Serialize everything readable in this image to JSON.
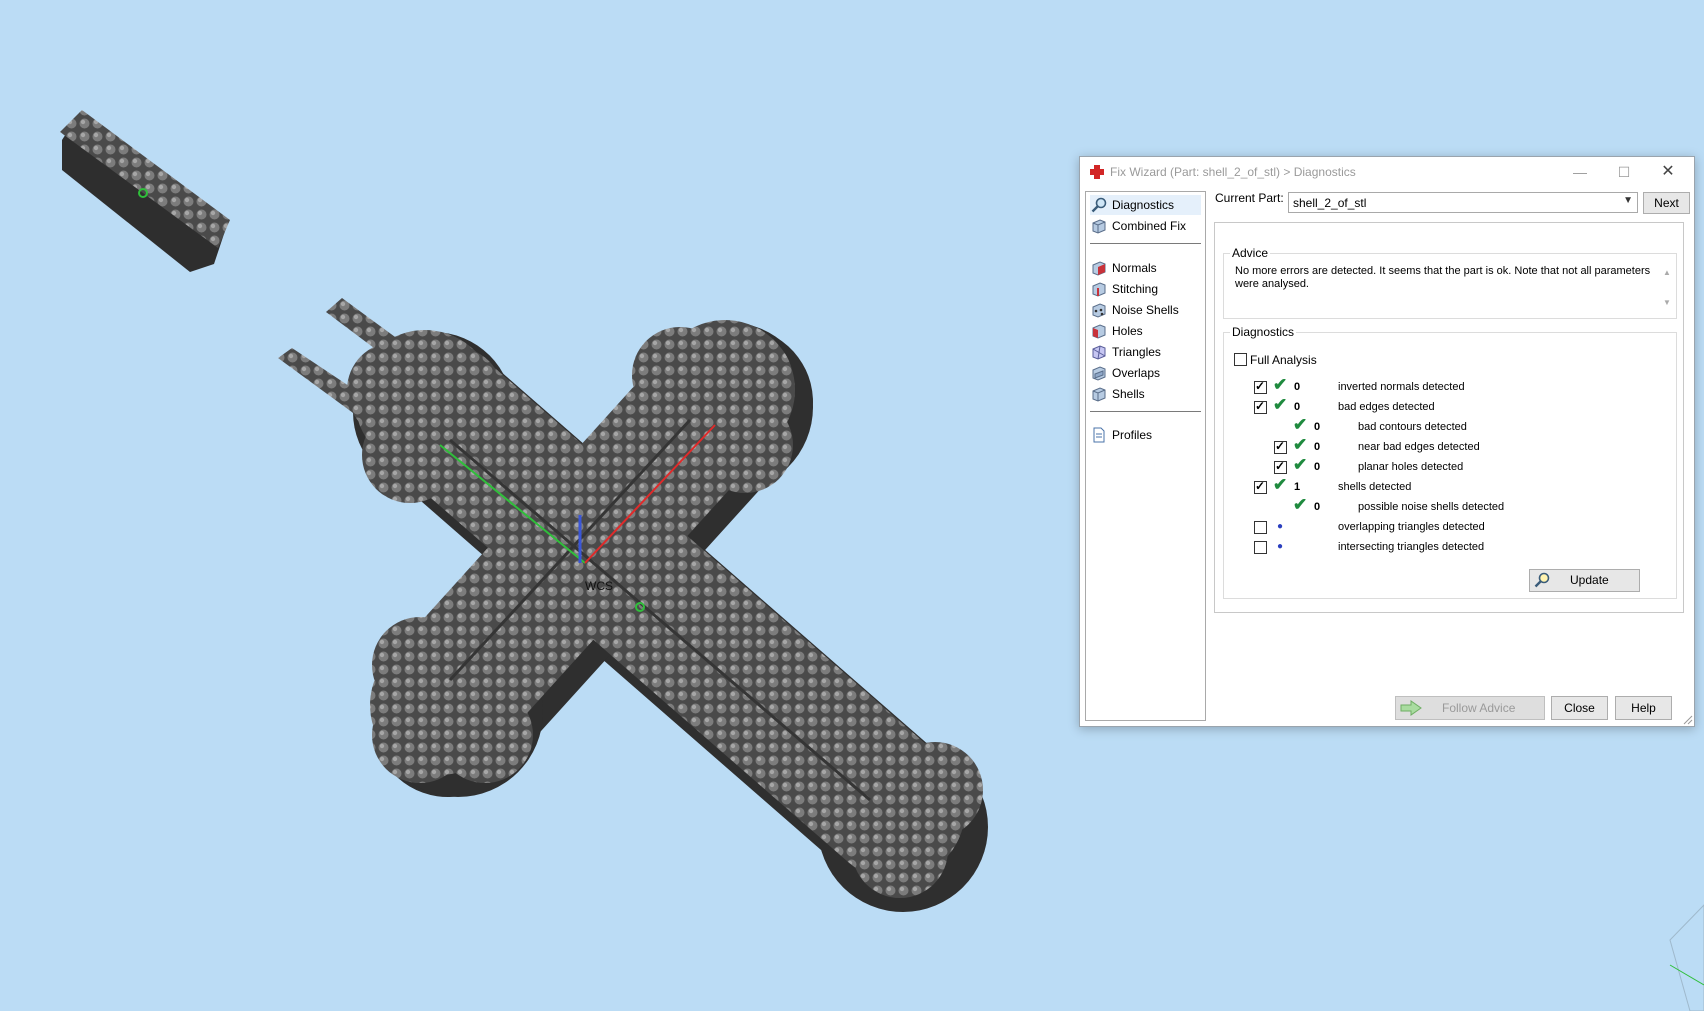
{
  "window": {
    "title": "Fix Wizard (Part: shell_2_of_stl) > Diagnostics",
    "min_glyph": "—",
    "max_glyph": "☐",
    "close_glyph": "✕"
  },
  "viewport": {
    "triad_label": "WCS",
    "background_color": "#bbdcf5"
  },
  "nav": {
    "items": [
      {
        "label": "Diagnostics",
        "icon": "magnifier-icon"
      },
      {
        "label": "Combined Fix",
        "icon": "cube-icon"
      },
      {
        "label": "Normals",
        "icon": "cube-red-face-icon"
      },
      {
        "label": "Stitching",
        "icon": "cube-stitch-icon"
      },
      {
        "label": "Noise Shells",
        "icon": "cube-dots-icon"
      },
      {
        "label": "Holes",
        "icon": "cube-hole-icon"
      },
      {
        "label": "Triangles",
        "icon": "triangles-icon"
      },
      {
        "label": "Overlaps",
        "icon": "overlaps-icon"
      },
      {
        "label": "Shells",
        "icon": "shells-icon"
      },
      {
        "label": "Profiles",
        "icon": "document-icon"
      }
    ]
  },
  "current_part": {
    "label": "Current Part:",
    "value": "shell_2_of_stl",
    "next_label": "Next"
  },
  "advice": {
    "title": "Advice",
    "text": "No more errors are detected. It seems that the part is ok. Note that not all parameters were analysed."
  },
  "diagnostics": {
    "title": "Diagnostics",
    "full_analysis_label": "Full Analysis",
    "rows": [
      {
        "count": "0",
        "label": "inverted normals detected"
      },
      {
        "count": "0",
        "label": "bad edges detected"
      },
      {
        "count": "0",
        "label": "bad contours detected"
      },
      {
        "count": "0",
        "label": "near bad edges detected"
      },
      {
        "count": "0",
        "label": "planar holes detected"
      },
      {
        "count": "1",
        "label": "shells detected"
      },
      {
        "count": "0",
        "label": "possible noise shells detected"
      },
      {
        "count": "",
        "label": "overlapping triangles detected"
      },
      {
        "count": "",
        "label": "intersecting triangles detected"
      }
    ],
    "update_label": "Update"
  },
  "footer": {
    "follow_advice_label": "Follow Advice",
    "close_label": "Close",
    "help_label": "Help"
  },
  "colors": {
    "check_green": "#1f8a3e",
    "pending_dot": "#2b3fbf"
  }
}
